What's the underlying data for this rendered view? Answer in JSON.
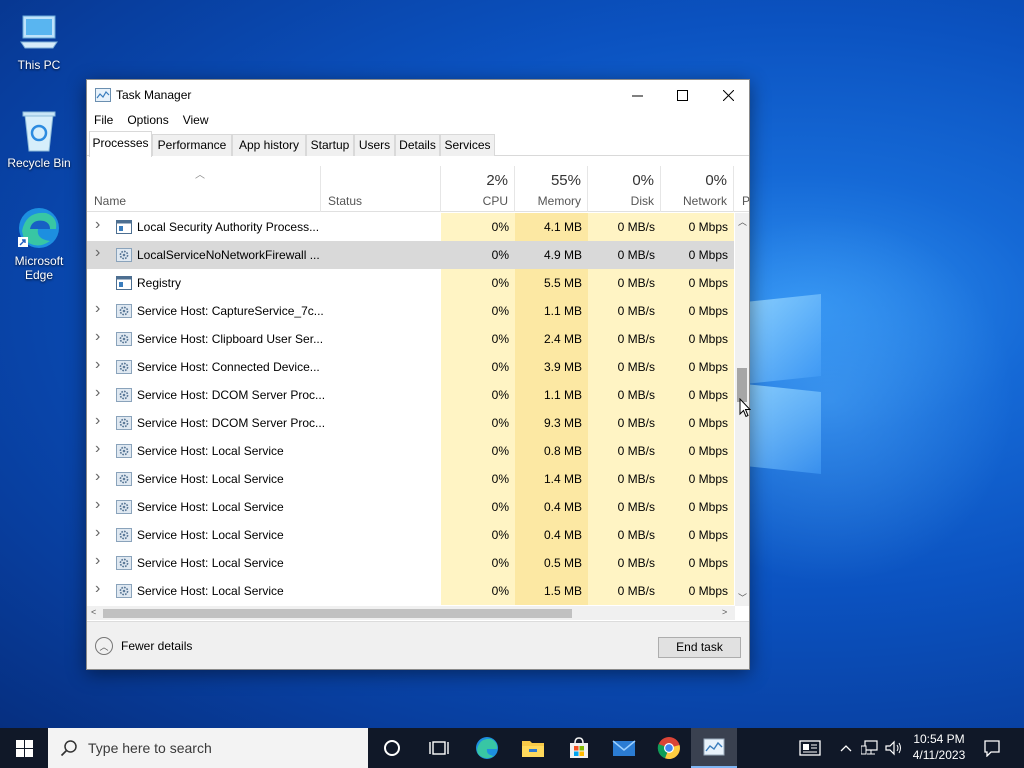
{
  "desktop": {
    "icons": [
      {
        "label": "This PC"
      },
      {
        "label": "Recycle Bin"
      },
      {
        "label": "Microsoft Edge"
      }
    ]
  },
  "window": {
    "title": "Task Manager",
    "menu": [
      "File",
      "Options",
      "View"
    ],
    "tabs": [
      "Processes",
      "Performance",
      "App history",
      "Startup",
      "Users",
      "Details",
      "Services"
    ],
    "active_tab": "Processes",
    "columns": {
      "name": "Name",
      "status": "Status",
      "cpu": {
        "pct": "2%",
        "label": "CPU"
      },
      "memory": {
        "pct": "55%",
        "label": "Memory"
      },
      "disk": {
        "pct": "0%",
        "label": "Disk"
      },
      "network": {
        "pct": "0%",
        "label": "Network"
      },
      "power": "P"
    },
    "rows": [
      {
        "name": "Local Security Authority Process...",
        "expand": true,
        "cpu": "0%",
        "memory": "4.1 MB",
        "disk": "0 MB/s",
        "network": "0 Mbps",
        "icon": "window-icon"
      },
      {
        "name": "LocalServiceNoNetworkFirewall ...",
        "expand": true,
        "cpu": "0%",
        "memory": "4.9 MB",
        "disk": "0 MB/s",
        "network": "0 Mbps",
        "icon": "gear-icon",
        "selected": true
      },
      {
        "name": "Registry",
        "expand": false,
        "cpu": "0%",
        "memory": "5.5 MB",
        "disk": "0 MB/s",
        "network": "0 Mbps",
        "icon": "window-icon"
      },
      {
        "name": "Service Host: CaptureService_7c...",
        "expand": true,
        "cpu": "0%",
        "memory": "1.1 MB",
        "disk": "0 MB/s",
        "network": "0 Mbps",
        "icon": "gear-icon"
      },
      {
        "name": "Service Host: Clipboard User Ser...",
        "expand": true,
        "cpu": "0%",
        "memory": "2.4 MB",
        "disk": "0 MB/s",
        "network": "0 Mbps",
        "icon": "gear-icon"
      },
      {
        "name": "Service Host: Connected Device...",
        "expand": true,
        "cpu": "0%",
        "memory": "3.9 MB",
        "disk": "0 MB/s",
        "network": "0 Mbps",
        "icon": "gear-icon"
      },
      {
        "name": "Service Host: DCOM Server Proc...",
        "expand": true,
        "cpu": "0%",
        "memory": "1.1 MB",
        "disk": "0 MB/s",
        "network": "0 Mbps",
        "icon": "gear-icon"
      },
      {
        "name": "Service Host: DCOM Server Proc...",
        "expand": true,
        "cpu": "0%",
        "memory": "9.3 MB",
        "disk": "0 MB/s",
        "network": "0 Mbps",
        "icon": "gear-icon"
      },
      {
        "name": "Service Host: Local Service",
        "expand": true,
        "cpu": "0%",
        "memory": "0.8 MB",
        "disk": "0 MB/s",
        "network": "0 Mbps",
        "icon": "gear-icon"
      },
      {
        "name": "Service Host: Local Service",
        "expand": true,
        "cpu": "0%",
        "memory": "1.4 MB",
        "disk": "0 MB/s",
        "network": "0 Mbps",
        "icon": "gear-icon"
      },
      {
        "name": "Service Host: Local Service",
        "expand": true,
        "cpu": "0%",
        "memory": "0.4 MB",
        "disk": "0 MB/s",
        "network": "0 Mbps",
        "icon": "gear-icon"
      },
      {
        "name": "Service Host: Local Service",
        "expand": true,
        "cpu": "0%",
        "memory": "0.4 MB",
        "disk": "0 MB/s",
        "network": "0 Mbps",
        "icon": "gear-icon"
      },
      {
        "name": "Service Host: Local Service",
        "expand": true,
        "cpu": "0%",
        "memory": "0.5 MB",
        "disk": "0 MB/s",
        "network": "0 Mbps",
        "icon": "gear-icon"
      },
      {
        "name": "Service Host: Local Service",
        "expand": true,
        "cpu": "0%",
        "memory": "1.5 MB",
        "disk": "0 MB/s",
        "network": "0 Mbps",
        "icon": "gear-icon"
      }
    ],
    "footer": {
      "fewer_details": "Fewer details",
      "end_task": "End task"
    }
  },
  "taskbar": {
    "search_placeholder": "Type here to search",
    "time": "10:54 PM",
    "date": "4/11/2023",
    "apps": [
      "cortana-icon",
      "task-view-icon",
      "edge-icon",
      "file-explorer-icon",
      "store-icon",
      "mail-icon",
      "chrome-icon",
      "task-manager-icon"
    ]
  },
  "colors": {
    "cpu_cell": "#fff4c4",
    "memory_cell": "#fce8a3",
    "selected_row": "#d9d9d9",
    "taskbar": "#101828"
  }
}
